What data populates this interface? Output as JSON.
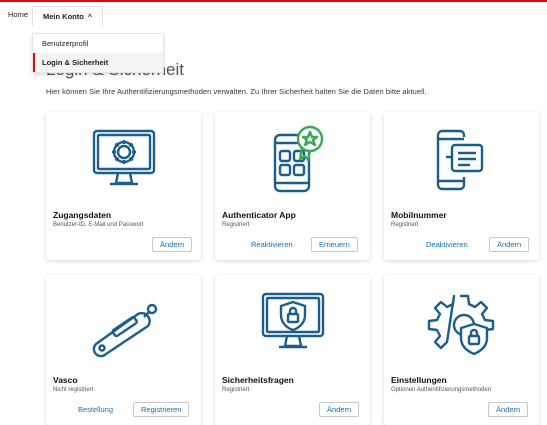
{
  "nav": {
    "home": "Home",
    "mein_konto": "Mein Konto",
    "menu": [
      {
        "label": "Benutzerprofil"
      },
      {
        "label": "Login & Sicherheit"
      }
    ]
  },
  "page": {
    "title": "Login & Sicherheit",
    "intro": "Hier können Sie Ihre Authentifizierungsmethoden verwalten. Zu Ihrer Sicherheit halten Sie die Daten bitte aktuell."
  },
  "cards": [
    {
      "icon": "monitor-gear-icon",
      "title": "Zugangsdaten",
      "subtitle": "Benutzer-ID, E-Mail und Passwort",
      "buttons": [
        "Ändern"
      ]
    },
    {
      "icon": "smartphone-badge-icon",
      "title": "Authenticator App",
      "subtitle": "Registriert",
      "buttons": [
        "Reaktivieren",
        "Erneuern"
      ]
    },
    {
      "icon": "smartphone-chat-icon",
      "title": "Mobilnummer",
      "subtitle": "Registriert",
      "buttons": [
        "Deaktivieren",
        "Ändern"
      ]
    },
    {
      "icon": "usb-token-icon",
      "title": "Vasco",
      "subtitle": "Nicht registriert",
      "buttons": [
        "Bestellung",
        "Registrieren"
      ]
    },
    {
      "icon": "monitor-shield-lock-icon",
      "title": "Sicherheitsfragen",
      "subtitle": "Registriert",
      "buttons": [
        "Ändern"
      ]
    },
    {
      "icon": "gear-shield-lock-icon",
      "title": "Einstellungen",
      "subtitle": "Optionen Authentifizierungsmethoden",
      "buttons": [
        "Ändern"
      ]
    }
  ],
  "colors": {
    "accent": "#e30613",
    "icon": "#1b5e8c",
    "icon_accent": "#3aa856",
    "link": "#1a6fb3"
  }
}
